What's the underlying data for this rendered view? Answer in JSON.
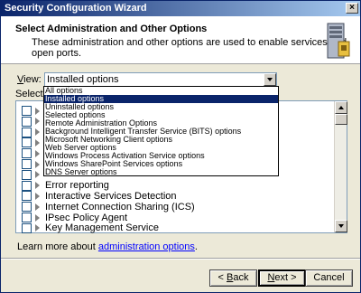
{
  "window": {
    "title": "Security Configuration Wizard",
    "close_label": "×"
  },
  "header": {
    "title": "Select Administration and Other Options",
    "subtitle": "These administration and other options are used to enable services and open ports.",
    "icon": "server-icon"
  },
  "view": {
    "label_prefix": "",
    "label_accel": "V",
    "label_rest": "iew:",
    "selected": "Installed options",
    "options": [
      "All options",
      "Installed options",
      "Uninstalled options",
      "Selected options",
      "Remote Administration Options",
      "Background Intelligent Transfer Service (BITS) options",
      "Microsoft Networking Client options",
      "Web Server options",
      "Windows Process Activation Service options",
      "Windows SharePoint Services options",
      "DNS Server options"
    ],
    "highlighted_index": 1
  },
  "select_label": "Select th",
  "list": {
    "items": [
      {
        "label": "",
        "checked": false
      },
      {
        "label": "",
        "checked": false
      },
      {
        "label": "",
        "checked": false
      },
      {
        "label": "",
        "checked": false
      },
      {
        "label": "",
        "checked": false
      },
      {
        "label": "",
        "checked": false
      },
      {
        "label": "",
        "checked": false
      },
      {
        "label": "Error reporting",
        "checked": false
      },
      {
        "label": "Interactive Services Detection",
        "checked": false
      },
      {
        "label": "Internet Connection Sharing (ICS)",
        "checked": false
      },
      {
        "label": "IPsec Policy Agent",
        "checked": false
      },
      {
        "label": "Key Management Service",
        "checked": false
      }
    ]
  },
  "learn_more": {
    "prefix": "Learn more about ",
    "link": "administration options",
    "suffix": "."
  },
  "buttons": {
    "back": {
      "accel": "B",
      "rest": "ack",
      "prefix": "< "
    },
    "next": {
      "accel": "N",
      "rest": "ext >",
      "prefix": ""
    },
    "cancel": {
      "label": "Cancel"
    }
  }
}
